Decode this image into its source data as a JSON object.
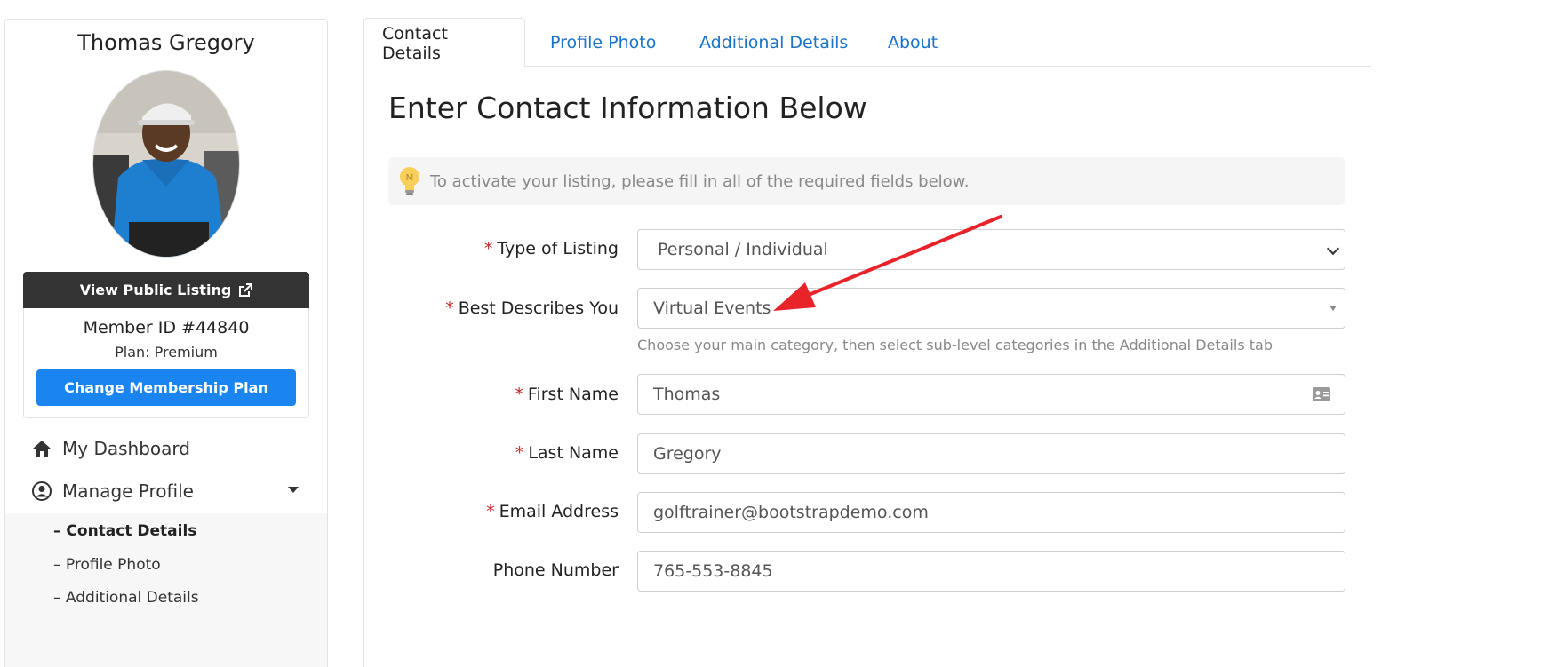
{
  "sidebar": {
    "member_name": "Thomas Gregory",
    "view_listing_label": "View Public Listing",
    "member_id": "Member ID #44840",
    "plan": "Plan: Premium",
    "change_plan_label": "Change Membership Plan",
    "nav": {
      "dashboard": "My Dashboard",
      "manage_profile": "Manage Profile"
    },
    "subnav": [
      {
        "label": "– Contact Details",
        "active": true
      },
      {
        "label": "– Profile Photo",
        "active": false
      },
      {
        "label": "– Additional Details",
        "active": false
      }
    ]
  },
  "tabs": [
    {
      "label": "Contact Details",
      "active": true
    },
    {
      "label": "Profile Photo",
      "active": false
    },
    {
      "label": "Additional Details",
      "active": false
    },
    {
      "label": "About",
      "active": false
    }
  ],
  "form": {
    "title": "Enter Contact Information Below",
    "alert": "To activate your listing, please fill in all of the required fields below.",
    "required_mark": "*",
    "fields": {
      "type_of_listing": {
        "label": "Type of Listing",
        "value": "Personal / Individual"
      },
      "best_describes": {
        "label": "Best Describes You",
        "value": "Virtual Events",
        "help": "Choose your main category, then select sub-level categories in the Additional Details tab"
      },
      "first_name": {
        "label": "First Name",
        "value": "Thomas"
      },
      "last_name": {
        "label": "Last Name",
        "value": "Gregory"
      },
      "email": {
        "label": "Email Address",
        "value": "golftrainer@bootstrapdemo.com"
      },
      "phone": {
        "label": "Phone Number",
        "value": "765-553-8845"
      }
    }
  },
  "colors": {
    "primary_button": "#1a85f0",
    "dark_button": "#333333",
    "link": "#1a73c8",
    "required": "#c62828",
    "annotation_arrow": "#e8232a"
  },
  "icons": [
    "external-link-icon",
    "home-icon",
    "user-circle-icon",
    "chevron-down-icon",
    "lightbulb-icon",
    "contact-card-icon"
  ]
}
